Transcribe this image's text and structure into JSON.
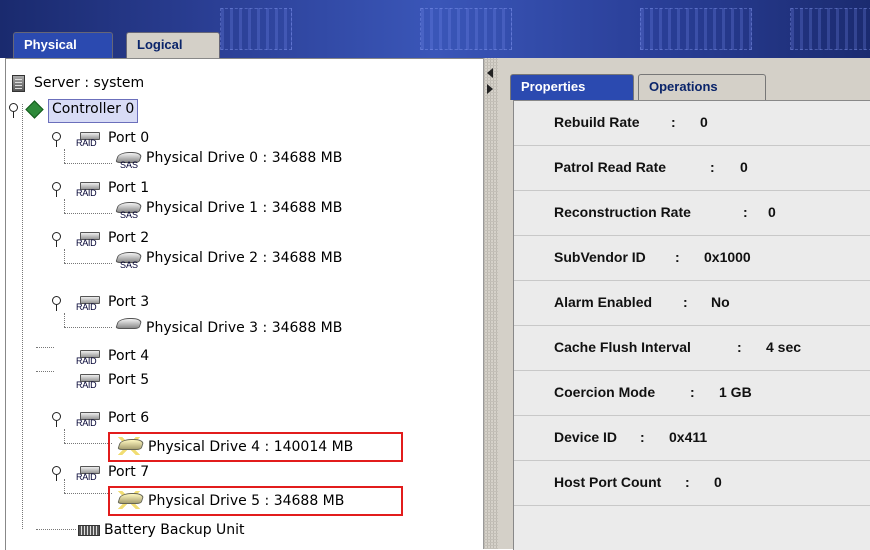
{
  "top_tabs": {
    "physical": "Physical",
    "logical": "Logical"
  },
  "tree": {
    "server": "Server : system",
    "controller": "Controller 0",
    "raid_text": "RAID",
    "sas_text": "SAS",
    "ports": [
      {
        "label": "Port 0",
        "drive": "Physical Drive 0 : 34688 MB"
      },
      {
        "label": "Port 1",
        "drive": "Physical Drive 1 : 34688 MB"
      },
      {
        "label": "Port 2",
        "drive": "Physical Drive 2 : 34688 MB"
      },
      {
        "label": "Port 3",
        "drive": "Physical Drive 3 : 34688 MB"
      },
      {
        "label": "Port 4"
      },
      {
        "label": "Port 5"
      },
      {
        "label": "Port 6",
        "drive": "Physical Drive 4 : 140014 MB"
      },
      {
        "label": "Port 7",
        "drive": "Physical Drive 5 : 34688 MB"
      }
    ],
    "battery": "Battery Backup Unit"
  },
  "right_tabs": {
    "properties": "Properties",
    "operations": "Operations"
  },
  "properties": [
    {
      "label": "Rebuild Rate",
      "sep": ":",
      "value": "0"
    },
    {
      "label": "Patrol Read Rate",
      "sep": ":",
      "value": "0"
    },
    {
      "label": "Reconstruction Rate",
      "sep": ":",
      "value": "0"
    },
    {
      "label": "SubVendor ID",
      "sep": ":",
      "value": "0x1000"
    },
    {
      "label": "Alarm Enabled",
      "sep": ":",
      "value": "No"
    },
    {
      "label": "Cache Flush Interval",
      "sep": ":",
      "value": "4 sec"
    },
    {
      "label": "Coercion Mode",
      "sep": ":",
      "value": "1 GB"
    },
    {
      "label": "Device ID",
      "sep": ":",
      "value": "0x411"
    },
    {
      "label": "Host Port Count",
      "sep": ":",
      "value": "0"
    }
  ],
  "colors": {
    "active_tab": "#2b4ab0",
    "highlight_border": "#e21c1c",
    "selection": "#d8dcf6"
  }
}
